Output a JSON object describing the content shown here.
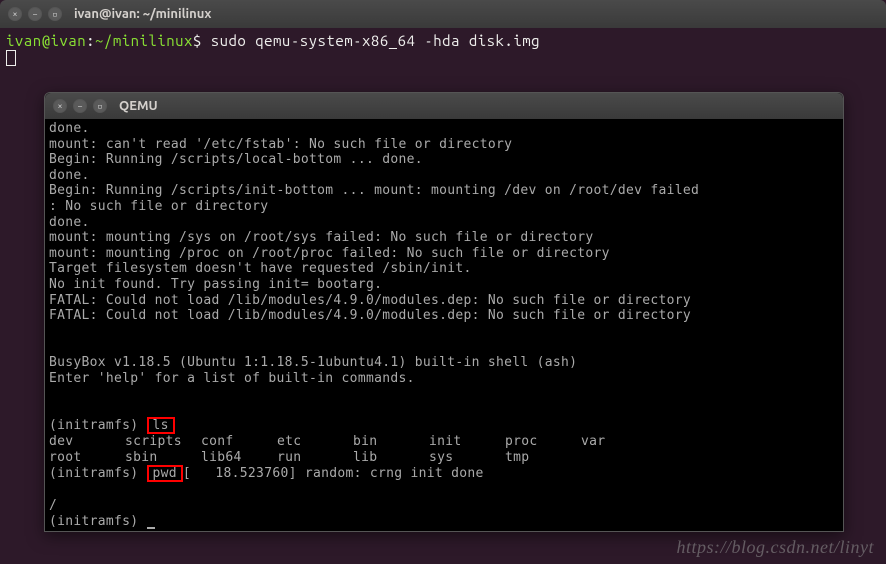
{
  "outer_window": {
    "title": "ivan@ivan: ~/minilinux",
    "prompt": {
      "user_host": "ivan@ivan",
      "sep1": ":",
      "path": "~/minilinux",
      "sep2": "$",
      "command": "sudo qemu-system-x86_64 -hda disk.img"
    }
  },
  "qemu_window": {
    "title": "QEMU",
    "boot_log": [
      "done.",
      "mount: can't read '/etc/fstab': No such file or directory",
      "Begin: Running /scripts/local-bottom ... done.",
      "done.",
      "Begin: Running /scripts/init-bottom ... mount: mounting /dev on /root/dev failed",
      ": No such file or directory",
      "done.",
      "mount: mounting /sys on /root/sys failed: No such file or directory",
      "mount: mounting /proc on /root/proc failed: No such file or directory",
      "Target filesystem doesn't have requested /sbin/init.",
      "No init found. Try passing init= bootarg.",
      "FATAL: Could not load /lib/modules/4.9.0/modules.dep: No such file or directory",
      "FATAL: Could not load /lib/modules/4.9.0/modules.dep: No such file or directory"
    ],
    "busybox_banner": "BusyBox v1.18.5 (Ubuntu 1:1.18.5-1ubuntu4.1) built-in shell (ash)",
    "busybox_help": "Enter 'help' for a list of built-in commands.",
    "prompt1": "(initramfs) ",
    "cmd_ls": "ls",
    "ls_row1": [
      "dev",
      "scripts",
      "conf",
      "etc",
      "bin",
      "init",
      "proc",
      "var"
    ],
    "ls_row2": [
      "root",
      "sbin",
      "lib64",
      "run",
      "lib",
      "sys",
      "tmp",
      ""
    ],
    "prompt2": "(initramfs) ",
    "cmd_pwd": "pwd",
    "pwd_trailer": "[   18.523760] random: crng init done",
    "pwd_output": "/",
    "prompt3": "(initramfs) "
  },
  "watermark": "https://blog.csdn.net/linyt"
}
